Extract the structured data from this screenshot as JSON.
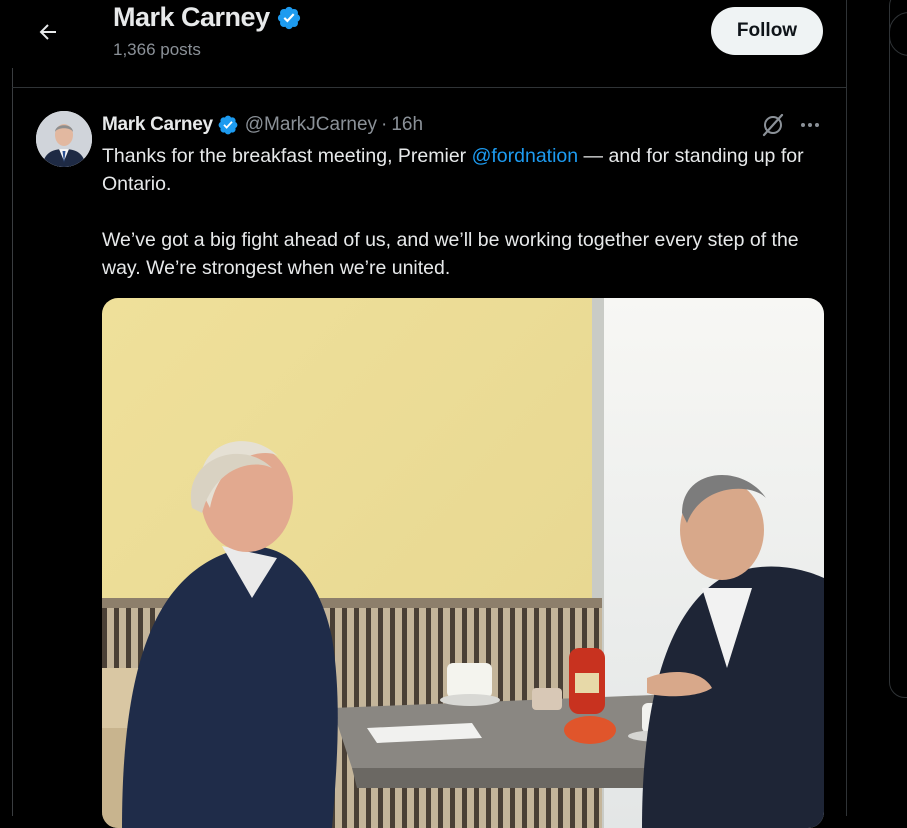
{
  "header": {
    "back_icon": "arrow-left-icon",
    "title": "Mark Carney",
    "verified_icon": "verified-badge-icon",
    "posts_count": "1,366 posts",
    "follow_label": "Follow"
  },
  "tweet": {
    "author_name": "Mark Carney",
    "handle": "@MarkJCarney",
    "separator": "·",
    "time": "16h",
    "text_before_mention": "Thanks for the breakfast meeting, Premier ",
    "mention": "@fordnation",
    "text_after_mention": " — and for standing up for Ontario.",
    "paragraph2": "We’ve got a big fight ahead of us, and we’ll be working together every step of the way. We’re strongest when we’re united.",
    "media_icon": "photo-image",
    "actions": [
      "grok-icon",
      "more-icon"
    ]
  },
  "colors": {
    "background": "#000000",
    "text": "#e7e9ea",
    "secondary_text": "#8b9198",
    "accent": "#1d9bf0",
    "follow_button_bg": "#eff3f4"
  }
}
